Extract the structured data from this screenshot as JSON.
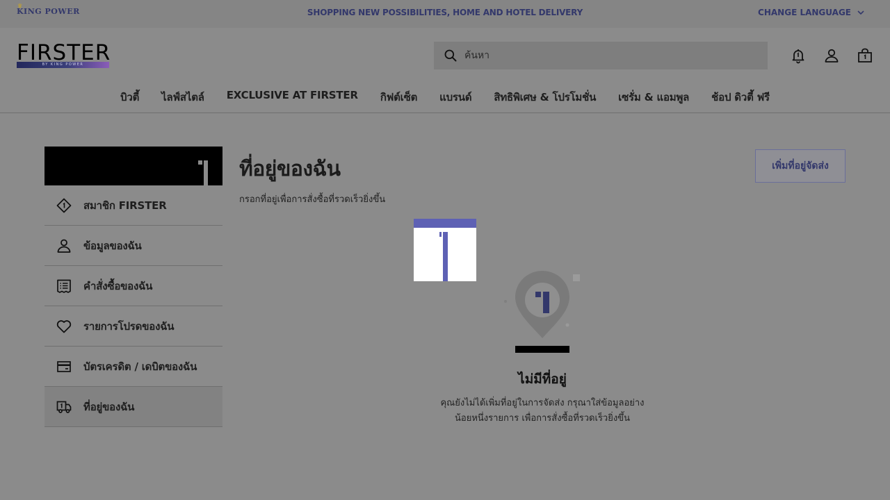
{
  "topbar": {
    "logo_text": "KING POWER",
    "promo": "SHOPPING NEW POSSIBILITIES, HOME AND HOTEL DELIVERY",
    "language_label": "CHANGE LANGUAGE"
  },
  "header": {
    "brand_word": "FIRSTER",
    "brand_tag": "BY KING POWER",
    "search_placeholder": "ค้นหา"
  },
  "nav": [
    "บิวตี้",
    "ไลฟ์สไตล์",
    "EXCLUSIVE AT FIRSTER",
    "กิฟต์เซ็ต",
    "แบรนด์",
    "สิทธิพิเศษ & โปรโมชั่น",
    "เซรั่ม & แอมพูล",
    "ช้อป ดิวตี้ ฟรี"
  ],
  "sidebar": {
    "items": [
      {
        "label": "สมาชิก FIRSTER",
        "icon": "member-diamond-icon"
      },
      {
        "label": "ข้อมูลของฉัน",
        "icon": "person-icon"
      },
      {
        "label": "คำสั่งซื้อของฉัน",
        "icon": "receipt-icon"
      },
      {
        "label": "รายการโปรดของฉัน",
        "icon": "heart-icon"
      },
      {
        "label": "บัตรเครดิต / เดบิตของฉัน",
        "icon": "credit-card-icon"
      },
      {
        "label": "ที่อยู่ของฉัน",
        "icon": "delivery-truck-icon"
      }
    ],
    "active_index": 5
  },
  "main": {
    "title": "ที่อยู่ของฉัน",
    "subtitle": "กรอกที่อยู่เพื่อการสั่งซื้อที่รวดเร็วยิ่งขึ้น",
    "add_button": "เพิ่มที่อยู่จัดส่ง",
    "empty_title": "ไม่มีที่อยู่",
    "empty_desc_line1": "คุณยังไม่ได้เพิ่มที่อยู่ในการจัดส่ง กรุณาใส่ข้อมูลอย่าง",
    "empty_desc_line2": "น้อยหนึ่งรายการ เพื่อการสั่งซื้อที่รวดเร็วยิ่งขึ้น"
  },
  "colors": {
    "accent": "#33386b",
    "overlay_bg": "#8b8b8b"
  }
}
